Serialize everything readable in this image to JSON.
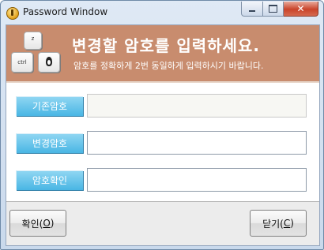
{
  "window": {
    "title": "Password Window",
    "icon": "app-icon",
    "controls": [
      "minimize-icon",
      "maximize-icon",
      "close-icon"
    ],
    "close_glyph": "✕"
  },
  "banner": {
    "title": "변경할 암호를 입력하세요.",
    "subtitle": "암호를 정확하게 2번 동일하게 입력하시기 바랍니다.",
    "image": "keyboard-keys-icon",
    "key_z": "z",
    "key_ctrl": "ctrl",
    "background_color": "#c88c6e"
  },
  "form": {
    "current_label": "기존암호",
    "current_value": "",
    "new_label": "변경암호",
    "new_value": "",
    "confirm_label": "암호확인",
    "confirm_value": ""
  },
  "footer": {
    "ok_label": "확인(",
    "ok_key": "O",
    "ok_suffix": ")",
    "close_label": "닫기(",
    "close_key": "C",
    "close_suffix": ")"
  },
  "colors": {
    "label_accent": "#49b6e4"
  }
}
